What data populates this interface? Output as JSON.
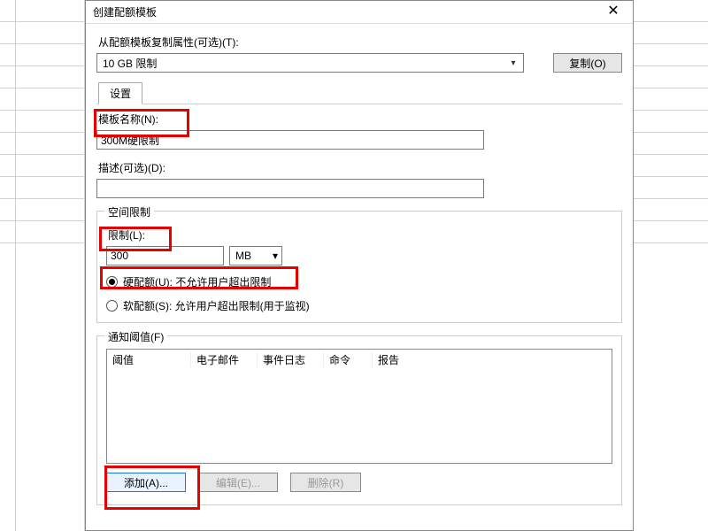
{
  "dialog": {
    "title": "创建配额模板",
    "copy_from_label": "从配额模板复制属性(可选)(T):",
    "template_select_value": "10 GB 限制",
    "copy_button": "复制(O)",
    "tab_settings": "设置",
    "template_name_label": "模板名称(N):",
    "template_name_value": "300M硬限制",
    "description_label": "描述(可选)(D):",
    "description_value": "",
    "space_limit_legend": "空间限制",
    "limit_label": "限制(L):",
    "limit_value": "300",
    "limit_unit": "MB",
    "radio_hard": "硬配额(U): 不允许用户超出限制",
    "radio_soft": "软配额(S): 允许用户超出限制(用于监视)",
    "threshold_legend": "通知阈值(F)",
    "table": {
      "threshold": "阈值",
      "email": "电子邮件",
      "eventlog": "事件日志",
      "command": "命令",
      "report": "报告"
    },
    "add_btn": "添加(A)...",
    "edit_btn": "编辑(E)...",
    "delete_btn": "删除(R)"
  }
}
